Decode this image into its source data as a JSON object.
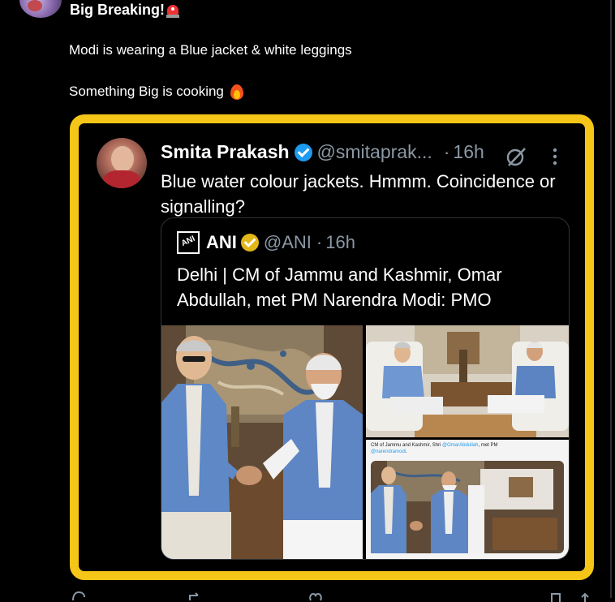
{
  "post": {
    "title": "Big Breaking!",
    "title_emoji_icon": "police-siren-icon",
    "line1": "Modi is wearing a Blue jacket & white leggings",
    "line2": "Something Big is cooking",
    "line2_emoji_icon": "fire-icon"
  },
  "embed": {
    "border_color": "#f5c518",
    "quoted_tweet": {
      "name": "Smita Prakash",
      "verified_icon": "blue-verified-badge-icon",
      "handle": "@smitaprak...",
      "separator": "·",
      "time": "16h",
      "text": "Blue water colour jackets. Hmmm. Coincidence or signalling?"
    },
    "inner_tweet": {
      "logo_text": "ANI",
      "name": "ANI",
      "verified_icon": "gold-verified-badge-icon",
      "handle": "@ANI",
      "separator": "·",
      "time": "16h",
      "text": "Delhi | CM of Jammu and Kashmir, Omar Abdullah, met PM Narendra Modi: PMO",
      "mini_caption_prefix": "CM of Jammu and Kashmir, Shri ",
      "mini_caption_link": "@OmarAbdullah",
      "mini_caption_mid": ", met PM ",
      "mini_caption_link2": "@narendramodi",
      "mini_caption_end": "."
    }
  },
  "colors": {
    "background": "#000000",
    "text": "#ffffff",
    "muted": "#8b98a5",
    "verified_blue": "#1d9bf0",
    "verified_gold": "#e2b719",
    "link": "#1d9bf0"
  }
}
